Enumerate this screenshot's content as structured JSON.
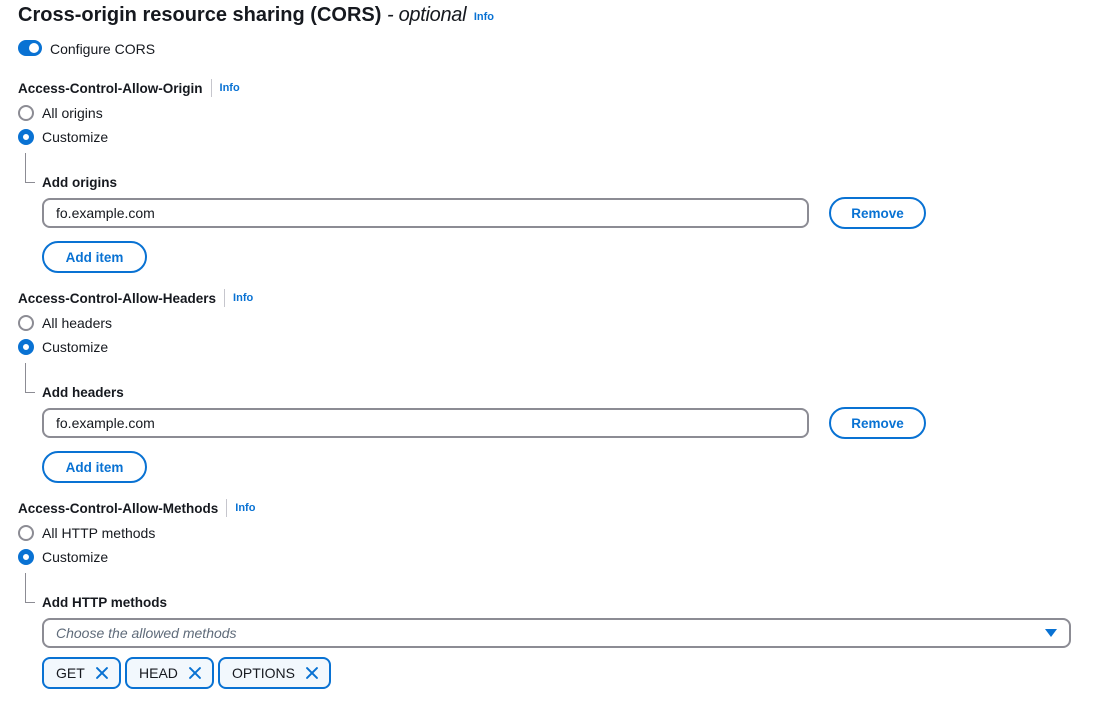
{
  "header": {
    "title": "Cross-origin resource sharing (CORS)",
    "title_suffix": "- optional",
    "info": "Info"
  },
  "toggle": {
    "label": "Configure CORS",
    "enabled": true
  },
  "origin": {
    "label": "Access-Control-Allow-Origin",
    "info": "Info",
    "option_all": "All origins",
    "option_custom": "Customize",
    "selected": "Customize",
    "add_label": "Add origins",
    "items": [
      "fo.example.com"
    ],
    "remove_label": "Remove",
    "add_item_label": "Add item"
  },
  "headers": {
    "label": "Access-Control-Allow-Headers",
    "info": "Info",
    "option_all": "All headers",
    "option_custom": "Customize",
    "selected": "Customize",
    "add_label": "Add headers",
    "items": [
      "fo.example.com"
    ],
    "remove_label": "Remove",
    "add_item_label": "Add item"
  },
  "methods": {
    "label": "Access-Control-Allow-Methods",
    "info": "Info",
    "option_all": "All HTTP methods",
    "option_custom": "Customize",
    "selected": "Customize",
    "add_label": "Add HTTP methods",
    "placeholder": "Choose the allowed methods",
    "tokens": [
      "GET",
      "HEAD",
      "OPTIONS"
    ]
  },
  "colors": {
    "accent": "#0972d3",
    "border": "#8c8c94",
    "text": "#16191f"
  }
}
